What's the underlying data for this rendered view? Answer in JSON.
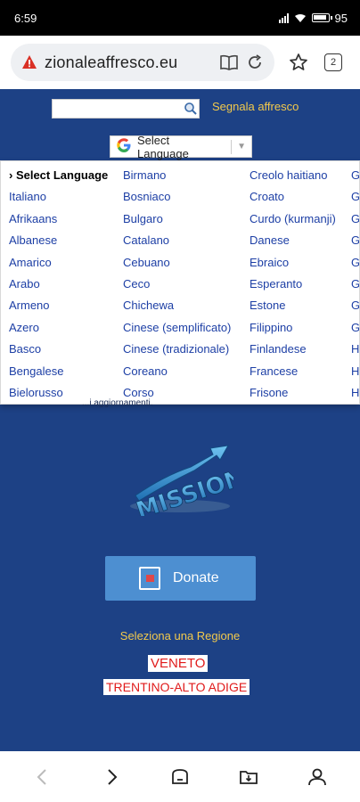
{
  "status": {
    "time": "6:59",
    "battery": "95"
  },
  "browser": {
    "url": "zionaleaffresco.eu",
    "tab_count": "2",
    "icons": [
      "warning-icon",
      "reader-mode-icon",
      "reload-icon",
      "star-icon",
      "tabs-icon"
    ]
  },
  "page": {
    "search": {
      "value": "",
      "placeholder": ""
    },
    "report_link": "Segnala affresco",
    "translate": {
      "label": "Select Language"
    },
    "language_columns": [
      [
        "› Select Language",
        "Italiano",
        "Afrikaans",
        "Albanese",
        "Amarico",
        "Arabo",
        "Armeno",
        "Azero",
        "Basco",
        "Bengalese",
        "Bielorusso"
      ],
      [
        "Birmano",
        "Bosniaco",
        "Bulgaro",
        "Catalano",
        "Cebuano",
        "Ceco",
        "Chichewa",
        "Cinese (semplificato)",
        "Cinese (tradizionale)",
        "Coreano",
        "Corso"
      ],
      [
        "Creolo haitiano",
        "Croato",
        "Curdo (kurmanji)",
        "Danese",
        "Ebraico",
        "Esperanto",
        "Estone",
        "Filippino",
        "Finlandese",
        "Francese",
        "Frisone"
      ],
      [
        "G",
        "G",
        "G",
        "G",
        "G",
        "G",
        "G",
        "G",
        "H",
        "H",
        "H"
      ]
    ],
    "underlay_text": "...i aggiornamenti.",
    "donate_label": "Donate",
    "region_title": "Seleziona una Regione",
    "regions": [
      "VENETO",
      "TRENTINO-ALTO ADIGE"
    ]
  },
  "colors": {
    "page_bg": "#1d4185",
    "accent_yellow": "#f2c94c",
    "donate_bg": "#4d8fd1",
    "region_red": "#e01b1b"
  }
}
